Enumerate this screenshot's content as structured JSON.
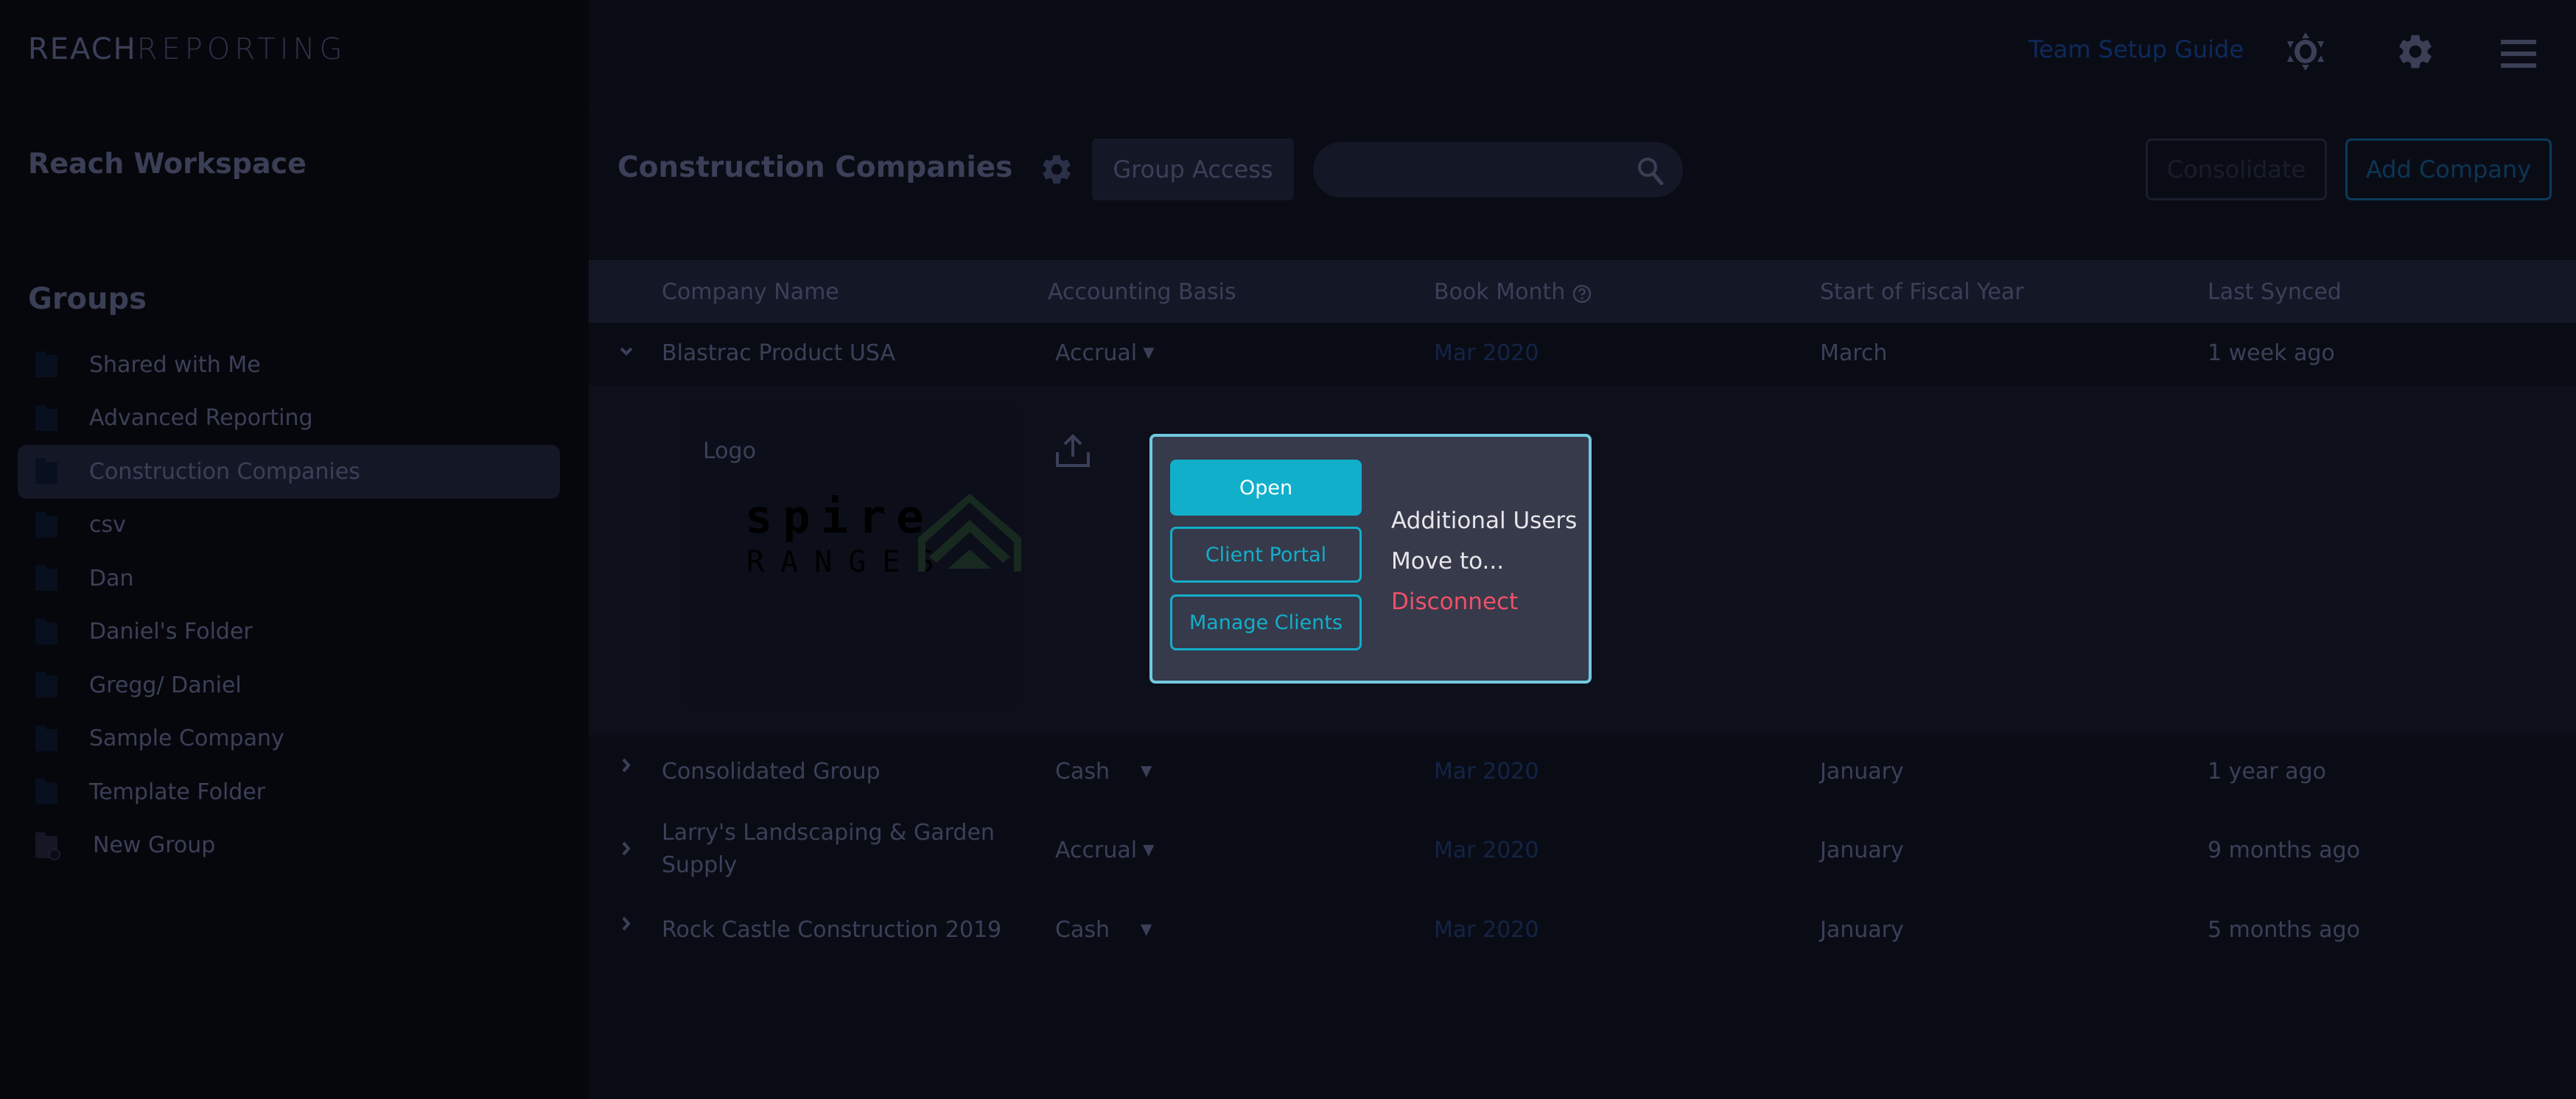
{
  "brand": {
    "part1": "REACH",
    "part2": "REPORTING"
  },
  "sidebar": {
    "workspace_title": "Reach Workspace",
    "groups_heading": "Groups",
    "groups": [
      {
        "label": "Shared with Me",
        "icon": "folder-icon",
        "selected": false
      },
      {
        "label": "Advanced Reporting",
        "icon": "folder-icon",
        "selected": false
      },
      {
        "label": "Construction Companies",
        "icon": "folder-icon",
        "selected": true
      },
      {
        "label": "csv",
        "icon": "folder-icon",
        "selected": false
      },
      {
        "label": "Dan",
        "icon": "folder-icon",
        "selected": false
      },
      {
        "label": "Daniel's Folder",
        "icon": "folder-icon",
        "selected": false
      },
      {
        "label": "Gregg/ Daniel",
        "icon": "folder-icon",
        "selected": false
      },
      {
        "label": "Sample Company",
        "icon": "folder-icon",
        "selected": false
      },
      {
        "label": "Template Folder",
        "icon": "folder-icon",
        "selected": false
      }
    ],
    "new_group_label": "New Group",
    "new_group_icon": "new-folder-icon"
  },
  "topbar": {
    "team_setup_guide": "Team Setup Guide",
    "icons": [
      "theme-toggle-icon",
      "settings-gear-icon",
      "hamburger-menu-icon"
    ]
  },
  "page": {
    "title": "Construction Companies",
    "group_settings_icon": "gear-icon",
    "group_access_label": "Group Access",
    "search": {
      "value": "",
      "placeholder": "",
      "icon": "search-icon"
    },
    "consolidate_label": "Consolidate",
    "add_company_label": "Add Company"
  },
  "table": {
    "columns": [
      "Company Name",
      "Accounting Basis",
      "Book Month",
      "Start of Fiscal Year",
      "Last Synced"
    ],
    "book_month_help_icon": "help-circle-icon",
    "rows": [
      {
        "name": "Blastrac Product USA",
        "basis": "Accrual",
        "book_month": "Mar 2020",
        "fiscal_start": "March",
        "last_synced": "1 week ago",
        "expanded": true
      },
      {
        "name": "Consolidated Group",
        "basis": "Cash",
        "book_month": "Mar 2020",
        "fiscal_start": "January",
        "last_synced": "1 year ago",
        "expanded": false
      },
      {
        "name": "Larry's Landscaping & Garden Supply",
        "basis": "Accrual",
        "book_month": "Mar 2020",
        "fiscal_start": "January",
        "last_synced": "9 months ago",
        "expanded": false
      },
      {
        "name": "Rock Castle Construction 2019",
        "basis": "Cash",
        "book_month": "Mar 2020",
        "fiscal_start": "January",
        "last_synced": "5 months ago",
        "expanded": false
      }
    ],
    "caret": "▼"
  },
  "expanded": {
    "logo_label": "Logo",
    "upload_icon": "upload-icon",
    "logo_image": {
      "line1": "spire",
      "line2": "RANGES"
    }
  },
  "popup": {
    "open_label": "Open",
    "client_portal_label": "Client Portal",
    "manage_clients_label": "Manage Clients",
    "additional_users_label": "Additional Users",
    "move_to_label": "Move to...",
    "disconnect_label": "Disconnect"
  },
  "colors": {
    "accent": "#12afcb",
    "popup_border": "#72c8e0",
    "danger": "#ef5068",
    "link": "#0d2a5c",
    "logo_green": "#182a20"
  }
}
